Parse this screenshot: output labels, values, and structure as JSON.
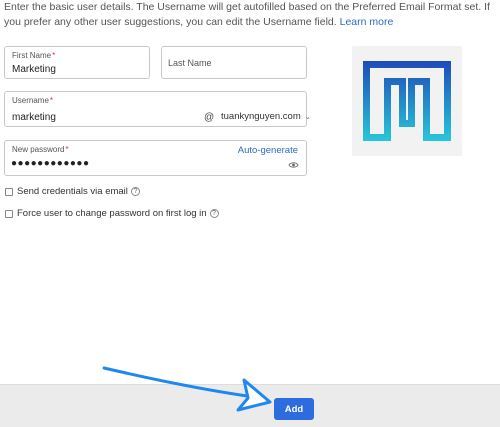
{
  "intro": {
    "text": "Enter the basic user details. The Username will get autofilled based on the Preferred Email Format set. If you prefer any other user suggestions, you can edit the Username field.",
    "learn_more": "Learn more"
  },
  "form": {
    "first_name": {
      "label": "First Name",
      "required": "*",
      "value": "Marketing"
    },
    "last_name": {
      "placeholder": "Last Name"
    },
    "username": {
      "label": "Username",
      "required": "*",
      "value": "marketing",
      "at": "@",
      "domain": "tuankynguyen.com"
    },
    "password": {
      "label": "New password",
      "required": "*",
      "value": "●●●●●●●●●●●●",
      "autogen": "Auto-generate"
    }
  },
  "options": {
    "send_credentials": "Send credentials via email",
    "force_change": "Force user to change password on first log in"
  },
  "footer": {
    "add_label": "Add"
  },
  "colors": {
    "accent": "#2d6cdf",
    "link": "#2d6cc0",
    "logo_top": "#1f4bb8",
    "logo_bottom": "#28c7d9"
  },
  "icons": {
    "eye": "eye-icon",
    "help": "help-icon",
    "chevron": "chevron-down-icon",
    "logo": "t-logo"
  }
}
